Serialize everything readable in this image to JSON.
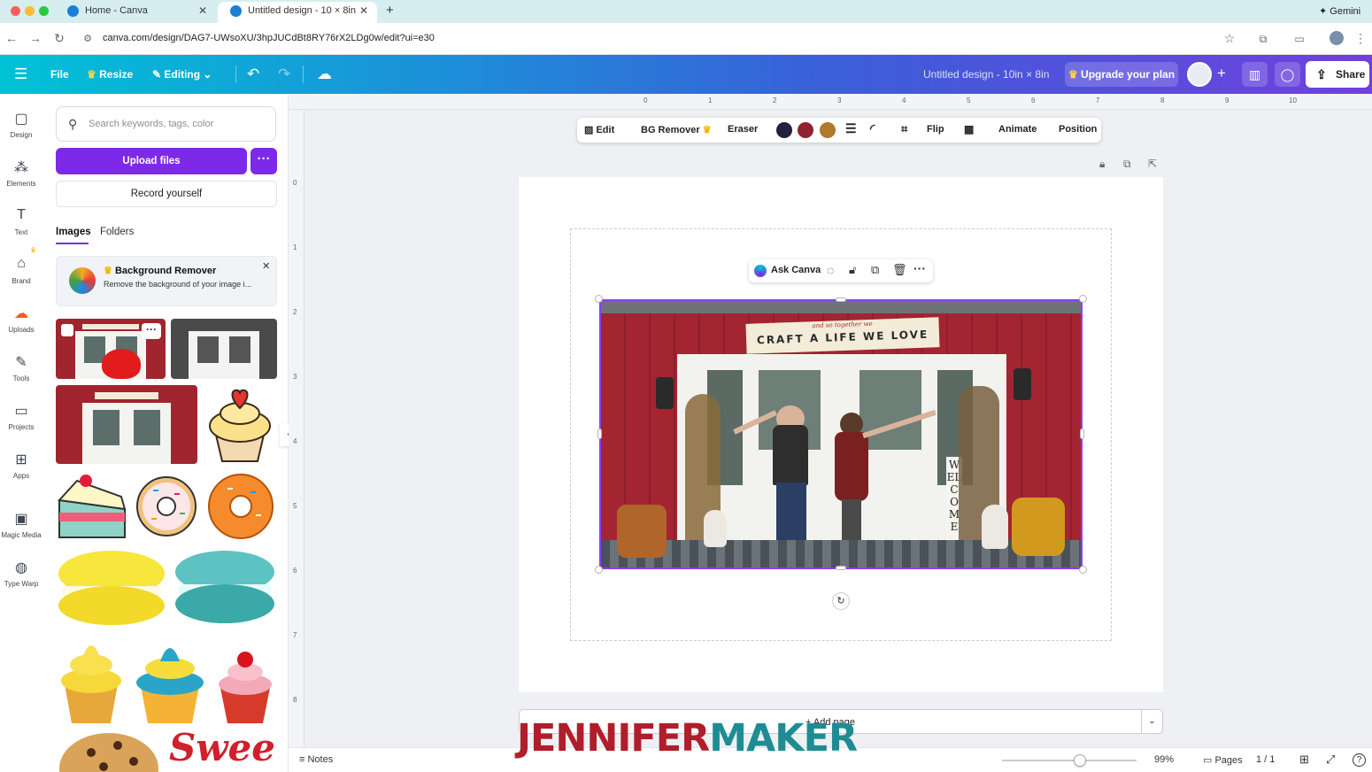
{
  "browser": {
    "tabs": [
      {
        "label": "Home - Canva"
      },
      {
        "label": "Untitled design - 10 × 8in"
      }
    ],
    "new_tab_icon": "plus-icon",
    "gemini_label": "Gemini",
    "url": "canva.com/design/DAG7-UWsoXU/3hpJUCdBt8RY76rX2LDg0w/edit?ui=e30"
  },
  "toolbar": {
    "file_label": "File",
    "resize_label": "Resize",
    "editing_label": "Editing",
    "design_title": "Untitled design - 10in × 8in",
    "upgrade_label": "Upgrade your plan",
    "share_label": "Share"
  },
  "rail": {
    "items": [
      {
        "label": "Design",
        "icon": "design-icon"
      },
      {
        "label": "Elements",
        "icon": "elements-icon"
      },
      {
        "label": "Text",
        "icon": "text-icon"
      },
      {
        "label": "Brand",
        "icon": "brand-icon"
      },
      {
        "label": "Uploads",
        "icon": "uploads-icon"
      },
      {
        "label": "Tools",
        "icon": "tools-icon"
      },
      {
        "label": "Projects",
        "icon": "projects-icon"
      },
      {
        "label": "Apps",
        "icon": "apps-icon"
      },
      {
        "label": "Magic Media",
        "icon": "magic-media-icon"
      },
      {
        "label": "Type Warp",
        "icon": "type-warp-icon"
      }
    ]
  },
  "panel": {
    "search_placeholder": "Search keywords, tags, color",
    "upload_label": "Upload files",
    "record_label": "Record yourself",
    "tabs": [
      "Images",
      "Folders"
    ],
    "bg_remover": {
      "title": "Background Remover",
      "desc": "Remove the background of your image i..."
    },
    "sweet_text": "Sweet"
  },
  "ruler": {
    "top": [
      "0",
      "1",
      "2",
      "3",
      "4",
      "5",
      "6",
      "7",
      "8",
      "9",
      "10"
    ],
    "left": [
      "0",
      "1",
      "2",
      "3",
      "4",
      "5",
      "6",
      "7",
      "8"
    ]
  },
  "context_toolbar": {
    "edit": "Edit",
    "bg_remover": "BG Remover",
    "eraser": "Eraser",
    "flip": "Flip",
    "animate": "Animate",
    "position": "Position",
    "colors": [
      "#23213d",
      "#8e2230",
      "#b07a2a"
    ]
  },
  "canvas": {
    "ask_canva": "Ask Canva",
    "banner_small": "and so together we",
    "banner_text": "CRAFT A LIFE WE LOVE",
    "welcome_text": "WELCOME",
    "add_page": "+ Add page"
  },
  "status": {
    "notes_label": "Notes",
    "zoom": "99%",
    "zoom_level": 0.58,
    "pages_label": "Pages",
    "page_count": "1 / 1"
  },
  "watermark": {
    "part1": "JENNIFER",
    "part2": "MAKER",
    "color1": "#b01e2b",
    "color2": "#1f8c94"
  }
}
